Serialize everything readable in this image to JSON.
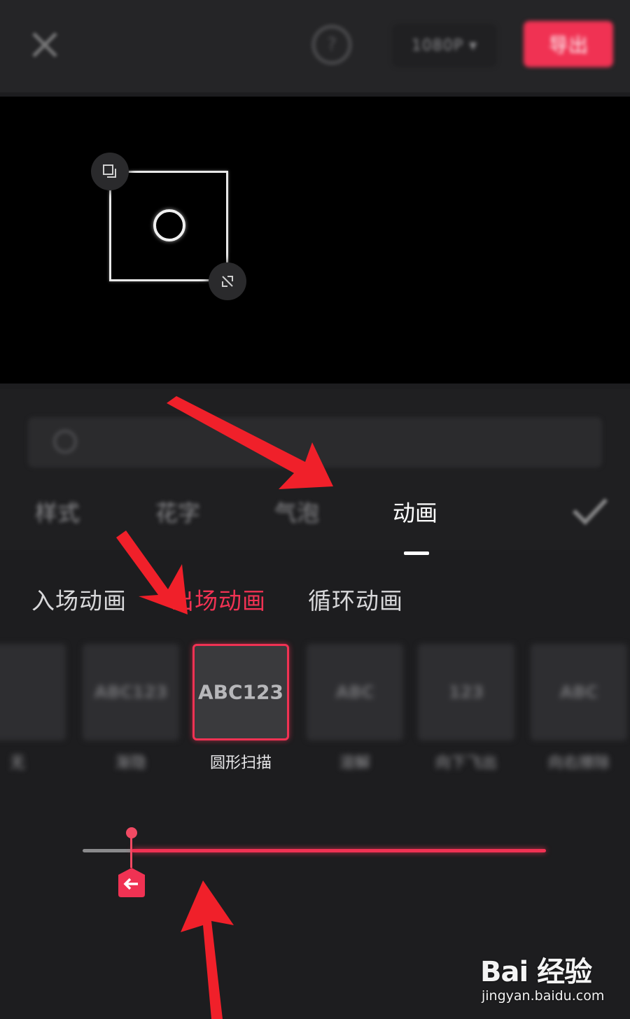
{
  "topbar": {
    "resolution": "1080P ▾",
    "export_label": "导出"
  },
  "text_panel": {
    "tabs": [
      {
        "label": "样式"
      },
      {
        "label": "花字"
      },
      {
        "label": "气泡"
      },
      {
        "label": "动画"
      }
    ],
    "active_tab": "动画"
  },
  "animation_panel": {
    "sub_tabs": [
      {
        "label": "入场动画"
      },
      {
        "label": "出场动画"
      },
      {
        "label": "循环动画"
      }
    ],
    "active_sub_tab": "出场动画",
    "presets": [
      {
        "thumb": "",
        "caption": "无"
      },
      {
        "thumb": "ABC123",
        "caption": "渐隐"
      },
      {
        "thumb": "ABC123",
        "caption": "圆形扫描"
      },
      {
        "thumb": "ABC",
        "caption": "溶解"
      },
      {
        "thumb": "123",
        "caption": "向下飞出"
      },
      {
        "thumb": "ABC",
        "caption": "向右擦除"
      }
    ],
    "selected_preset": "圆形扫描",
    "duration_fraction": 0.1
  },
  "watermark": {
    "logo": "Bai 经验",
    "url": "jingyan.baidu.com"
  },
  "colors": {
    "accent": "#f03253",
    "background": "#1d1d1f",
    "preview": "#000000"
  }
}
